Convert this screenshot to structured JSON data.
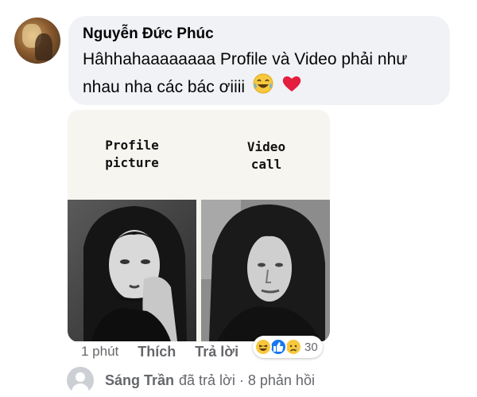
{
  "comment": {
    "author": "Nguyễn Đức Phúc",
    "text": "Hâhhahaaaaaaaa Profile và Video phải như nhau nha các bác ơiiii",
    "emojis": [
      "laughing-tears-emoji",
      "red-heart-emoji"
    ]
  },
  "meme": {
    "left_label": "Profile\npicture",
    "right_label": "Video\ncall"
  },
  "actions": {
    "time": "1 phút",
    "like": "Thích",
    "reply": "Trả lời"
  },
  "reactions": {
    "icons": [
      "haha-reaction-icon",
      "like-reaction-icon",
      "sad-reaction-icon"
    ],
    "count": "30"
  },
  "replies": {
    "name": "Sáng Trần",
    "replied": "đã trả lời",
    "separator": "·",
    "count": "8 phản hồi"
  },
  "colors": {
    "bubble": "#f0f2f5",
    "muted_text": "#65676b",
    "like_blue": "#1877f2",
    "heart_red": "#e41e3f"
  }
}
